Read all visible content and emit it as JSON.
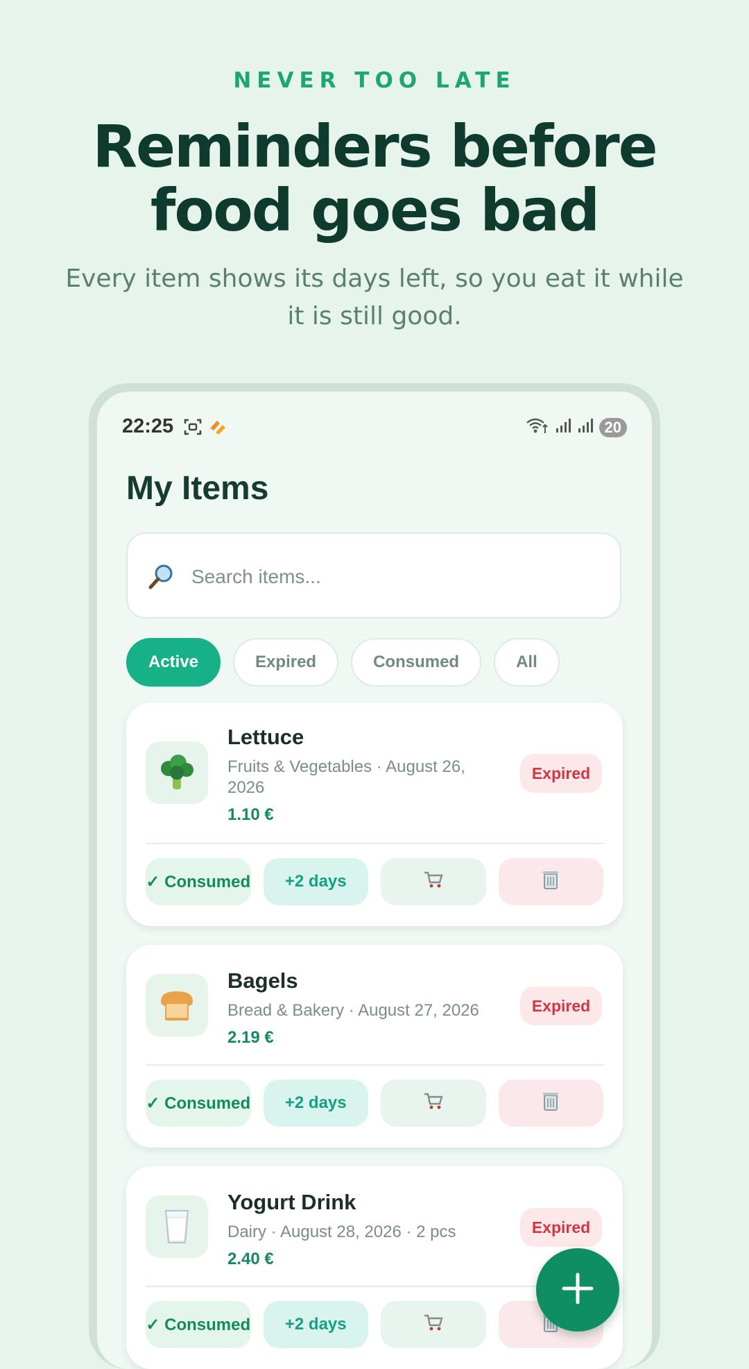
{
  "promo": {
    "kicker": "NEVER TOO LATE",
    "headline_line1": "Reminders before",
    "headline_line2": "food goes bad",
    "subline": "Every item shows its days left, so you eat it while it is still good."
  },
  "statusbar": {
    "time": "22:25",
    "battery": "20"
  },
  "screen": {
    "title": "My Items",
    "search": {
      "placeholder": "Search items...",
      "value": ""
    },
    "tabs": [
      {
        "label": "Active",
        "active": true
      },
      {
        "label": "Expired"
      },
      {
        "label": "Consumed"
      },
      {
        "label": "All"
      }
    ],
    "items": [
      {
        "name": "Lettuce",
        "meta": "Fruits & Vegetables · August 26, 2026",
        "price": "1.10 €",
        "status": "Expired",
        "icon": "broccoli-icon",
        "consumed_label": "✓ Consumed",
        "extend_label": "+2 days"
      },
      {
        "name": "Bagels",
        "meta": "Bread & Bakery · August 27, 2026",
        "price": "2.19 €",
        "status": "Expired",
        "icon": "bread-icon",
        "consumed_label": "✓ Consumed",
        "extend_label": "+2 days"
      },
      {
        "name": "Yogurt Drink",
        "meta": "Dairy · August 28, 2026 · 2 pcs",
        "price": "2.40 €",
        "status": "Expired",
        "icon": "glass-icon",
        "consumed_label": "✓ Consumed",
        "extend_label": "+2 days"
      }
    ]
  },
  "colors": {
    "background": "#e6f4ec",
    "accent": "#16b187",
    "headline": "#0e3b2d",
    "expired_badge": "#d43542",
    "fab": "#0f8d63"
  }
}
